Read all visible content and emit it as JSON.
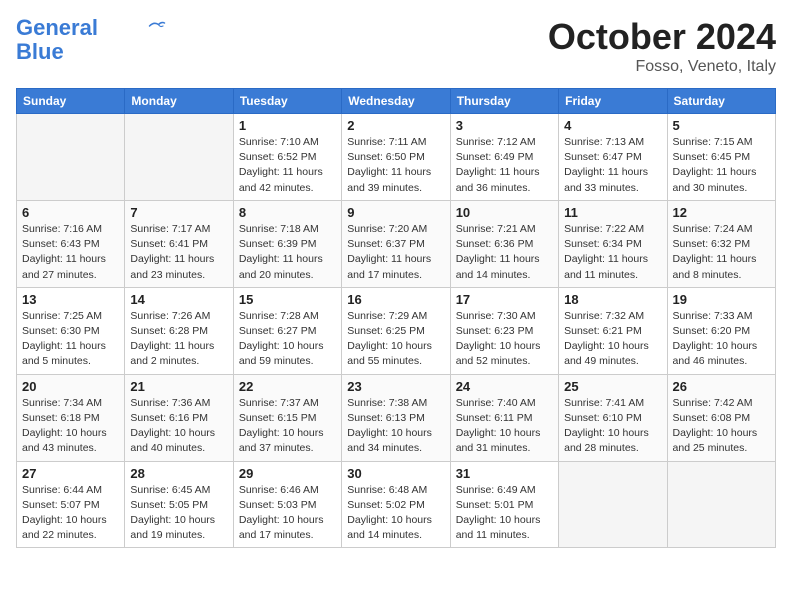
{
  "header": {
    "logo_line1": "General",
    "logo_line2": "Blue",
    "month": "October 2024",
    "location": "Fosso, Veneto, Italy"
  },
  "weekdays": [
    "Sunday",
    "Monday",
    "Tuesday",
    "Wednesday",
    "Thursday",
    "Friday",
    "Saturday"
  ],
  "weeks": [
    [
      {
        "day": "",
        "info": ""
      },
      {
        "day": "",
        "info": ""
      },
      {
        "day": "1",
        "info": "Sunrise: 7:10 AM\nSunset: 6:52 PM\nDaylight: 11 hours and 42 minutes."
      },
      {
        "day": "2",
        "info": "Sunrise: 7:11 AM\nSunset: 6:50 PM\nDaylight: 11 hours and 39 minutes."
      },
      {
        "day": "3",
        "info": "Sunrise: 7:12 AM\nSunset: 6:49 PM\nDaylight: 11 hours and 36 minutes."
      },
      {
        "day": "4",
        "info": "Sunrise: 7:13 AM\nSunset: 6:47 PM\nDaylight: 11 hours and 33 minutes."
      },
      {
        "day": "5",
        "info": "Sunrise: 7:15 AM\nSunset: 6:45 PM\nDaylight: 11 hours and 30 minutes."
      }
    ],
    [
      {
        "day": "6",
        "info": "Sunrise: 7:16 AM\nSunset: 6:43 PM\nDaylight: 11 hours and 27 minutes."
      },
      {
        "day": "7",
        "info": "Sunrise: 7:17 AM\nSunset: 6:41 PM\nDaylight: 11 hours and 23 minutes."
      },
      {
        "day": "8",
        "info": "Sunrise: 7:18 AM\nSunset: 6:39 PM\nDaylight: 11 hours and 20 minutes."
      },
      {
        "day": "9",
        "info": "Sunrise: 7:20 AM\nSunset: 6:37 PM\nDaylight: 11 hours and 17 minutes."
      },
      {
        "day": "10",
        "info": "Sunrise: 7:21 AM\nSunset: 6:36 PM\nDaylight: 11 hours and 14 minutes."
      },
      {
        "day": "11",
        "info": "Sunrise: 7:22 AM\nSunset: 6:34 PM\nDaylight: 11 hours and 11 minutes."
      },
      {
        "day": "12",
        "info": "Sunrise: 7:24 AM\nSunset: 6:32 PM\nDaylight: 11 hours and 8 minutes."
      }
    ],
    [
      {
        "day": "13",
        "info": "Sunrise: 7:25 AM\nSunset: 6:30 PM\nDaylight: 11 hours and 5 minutes."
      },
      {
        "day": "14",
        "info": "Sunrise: 7:26 AM\nSunset: 6:28 PM\nDaylight: 11 hours and 2 minutes."
      },
      {
        "day": "15",
        "info": "Sunrise: 7:28 AM\nSunset: 6:27 PM\nDaylight: 10 hours and 59 minutes."
      },
      {
        "day": "16",
        "info": "Sunrise: 7:29 AM\nSunset: 6:25 PM\nDaylight: 10 hours and 55 minutes."
      },
      {
        "day": "17",
        "info": "Sunrise: 7:30 AM\nSunset: 6:23 PM\nDaylight: 10 hours and 52 minutes."
      },
      {
        "day": "18",
        "info": "Sunrise: 7:32 AM\nSunset: 6:21 PM\nDaylight: 10 hours and 49 minutes."
      },
      {
        "day": "19",
        "info": "Sunrise: 7:33 AM\nSunset: 6:20 PM\nDaylight: 10 hours and 46 minutes."
      }
    ],
    [
      {
        "day": "20",
        "info": "Sunrise: 7:34 AM\nSunset: 6:18 PM\nDaylight: 10 hours and 43 minutes."
      },
      {
        "day": "21",
        "info": "Sunrise: 7:36 AM\nSunset: 6:16 PM\nDaylight: 10 hours and 40 minutes."
      },
      {
        "day": "22",
        "info": "Sunrise: 7:37 AM\nSunset: 6:15 PM\nDaylight: 10 hours and 37 minutes."
      },
      {
        "day": "23",
        "info": "Sunrise: 7:38 AM\nSunset: 6:13 PM\nDaylight: 10 hours and 34 minutes."
      },
      {
        "day": "24",
        "info": "Sunrise: 7:40 AM\nSunset: 6:11 PM\nDaylight: 10 hours and 31 minutes."
      },
      {
        "day": "25",
        "info": "Sunrise: 7:41 AM\nSunset: 6:10 PM\nDaylight: 10 hours and 28 minutes."
      },
      {
        "day": "26",
        "info": "Sunrise: 7:42 AM\nSunset: 6:08 PM\nDaylight: 10 hours and 25 minutes."
      }
    ],
    [
      {
        "day": "27",
        "info": "Sunrise: 6:44 AM\nSunset: 5:07 PM\nDaylight: 10 hours and 22 minutes."
      },
      {
        "day": "28",
        "info": "Sunrise: 6:45 AM\nSunset: 5:05 PM\nDaylight: 10 hours and 19 minutes."
      },
      {
        "day": "29",
        "info": "Sunrise: 6:46 AM\nSunset: 5:03 PM\nDaylight: 10 hours and 17 minutes."
      },
      {
        "day": "30",
        "info": "Sunrise: 6:48 AM\nSunset: 5:02 PM\nDaylight: 10 hours and 14 minutes."
      },
      {
        "day": "31",
        "info": "Sunrise: 6:49 AM\nSunset: 5:01 PM\nDaylight: 10 hours and 11 minutes."
      },
      {
        "day": "",
        "info": ""
      },
      {
        "day": "",
        "info": ""
      }
    ]
  ]
}
